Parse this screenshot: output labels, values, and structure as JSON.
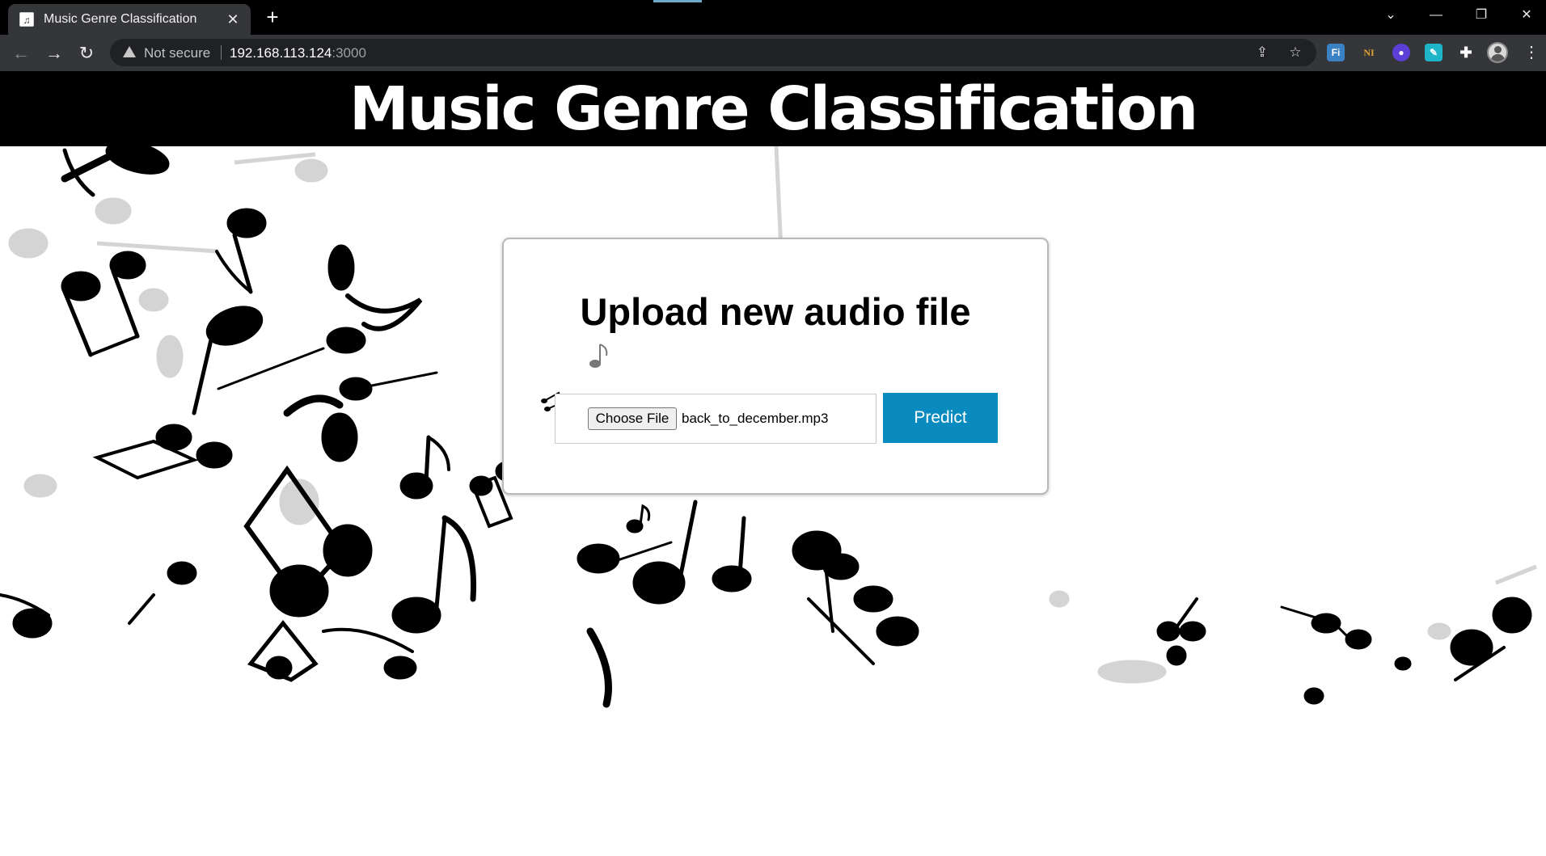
{
  "browser": {
    "tab_title": "Music Genre Classification",
    "security_label": "Not secure",
    "url_host": "192.168.113.124",
    "url_port": ":3000"
  },
  "page": {
    "title": "Music Genre Classification"
  },
  "upload": {
    "heading": "Upload new audio file",
    "choose_label": "Choose File",
    "file_name": "back_to_december.mp3",
    "predict_label": "Predict"
  },
  "colors": {
    "predict_button": "#0a8bbf",
    "header_bg": "#000000",
    "toolbar_bg": "#35363a"
  }
}
